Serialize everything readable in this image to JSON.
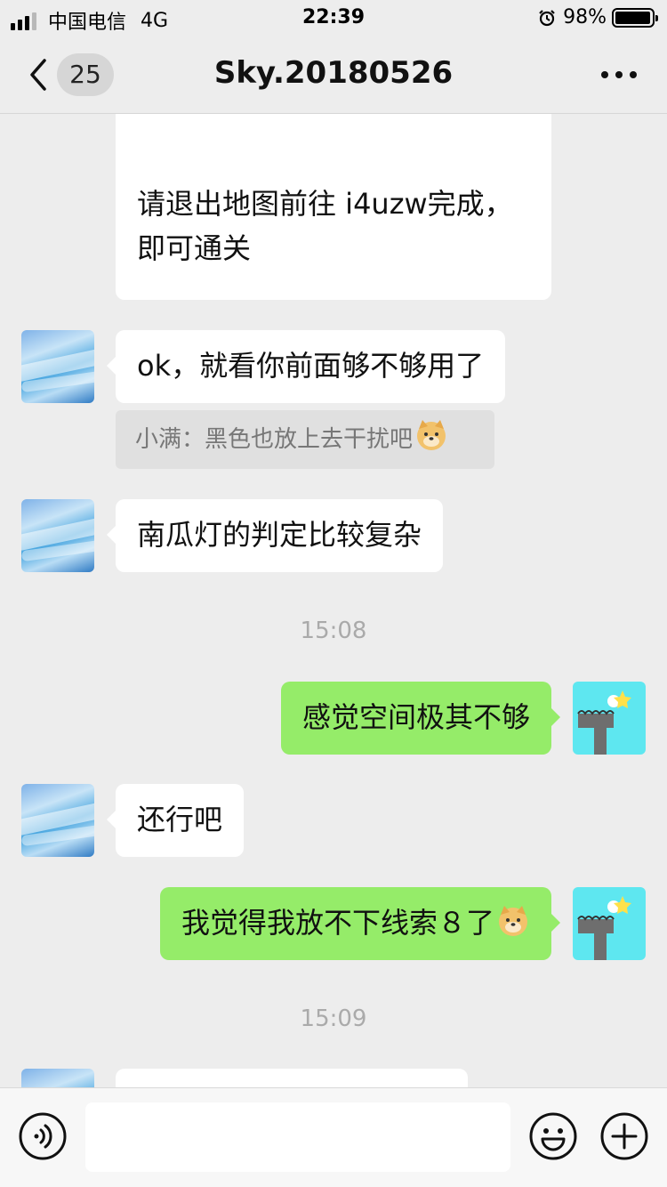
{
  "status_bar": {
    "carrier": "中国电信",
    "network": "4G",
    "time": "22:39",
    "battery": "98%",
    "battery_level": 0.98
  },
  "nav": {
    "unread_count": "25",
    "title": "Sky.20180526"
  },
  "messages": {
    "m1_line1": "请退出地图前往 i4uzw完成，",
    "m1_line2": "即可通关",
    "m2": "ok，就看你前面够不够用了",
    "m2_quote": "小满：黑色也放上去干扰吧",
    "m3": "南瓜灯的判定比较复杂",
    "ts1": "15:08",
    "m4": "感觉空间极其不够",
    "m5": "还行吧",
    "m6": "我觉得我放不下线索８了",
    "ts2": "15:09"
  },
  "icons": {
    "emoji_inline": "doge-emoji-icon",
    "voice": "voice-icon",
    "emoji_button": "smiley-icon",
    "plus": "plus-icon"
  },
  "colors": {
    "sent_bubble": "#95ec69",
    "received_bubble": "#ffffff",
    "background": "#ededed"
  }
}
